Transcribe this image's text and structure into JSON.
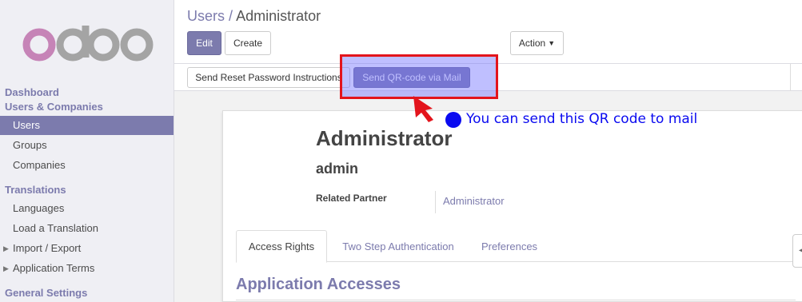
{
  "logo": {
    "text": "odoo"
  },
  "sidebar": {
    "sections": [
      {
        "label": "Dashboard"
      },
      {
        "label": "Users & Companies"
      },
      {
        "label": "Translations"
      },
      {
        "label": "General Settings"
      }
    ],
    "items": [
      {
        "label": "Users",
        "active": true
      },
      {
        "label": "Groups"
      },
      {
        "label": "Companies"
      },
      {
        "label": "Languages"
      },
      {
        "label": "Load a Translation"
      },
      {
        "label": "Import / Export"
      },
      {
        "label": "Application Terms"
      }
    ]
  },
  "breadcrumb": {
    "parent": "Users",
    "separator": "/",
    "current": "Administrator"
  },
  "toolbar": {
    "edit_label": "Edit",
    "create_label": "Create",
    "action_label": "Action"
  },
  "statusbar": {
    "reset_password_label": "Send Reset Password Instructions",
    "send_qr_label": "Send QR-code via Mail"
  },
  "record": {
    "name": "Administrator",
    "login": "admin",
    "related_partner_label": "Related Partner",
    "related_partner_value": "Administrator"
  },
  "tabs": [
    {
      "label": "Access Rights",
      "active": true
    },
    {
      "label": "Two Step Authentication"
    },
    {
      "label": "Preferences"
    }
  ],
  "section": {
    "title": "Application Accesses"
  },
  "annotation": {
    "text": "You can send this QR code to mail"
  },
  "colors": {
    "brand": "#7c7bad",
    "overlay": "#7070ff",
    "highlight_border": "#e3141c",
    "annotation": "#0a0af0"
  },
  "icons": {
    "caret": "caret-down-icon",
    "expand": "triangle-right-icon",
    "arrow": "pointer-arrow-icon"
  }
}
